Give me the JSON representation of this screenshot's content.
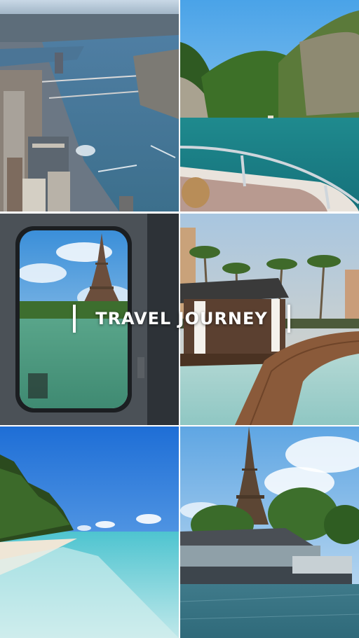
{
  "title": "TRAVEL JOURNEY",
  "photos": [
    {
      "subject": "aerial-city-river"
    },
    {
      "subject": "boat-lake-cliffs"
    },
    {
      "subject": "train-window-eiffel-tower"
    },
    {
      "subject": "resort-pool-palms"
    },
    {
      "subject": "tropical-beach"
    },
    {
      "subject": "eiffel-tower-river-boat"
    }
  ],
  "colors": {
    "sky": "#5fa6e3",
    "water": "#2f7f92",
    "lagoon": "#7fd6d8",
    "foliage": "#2e5a22",
    "text": "#ffffff"
  }
}
